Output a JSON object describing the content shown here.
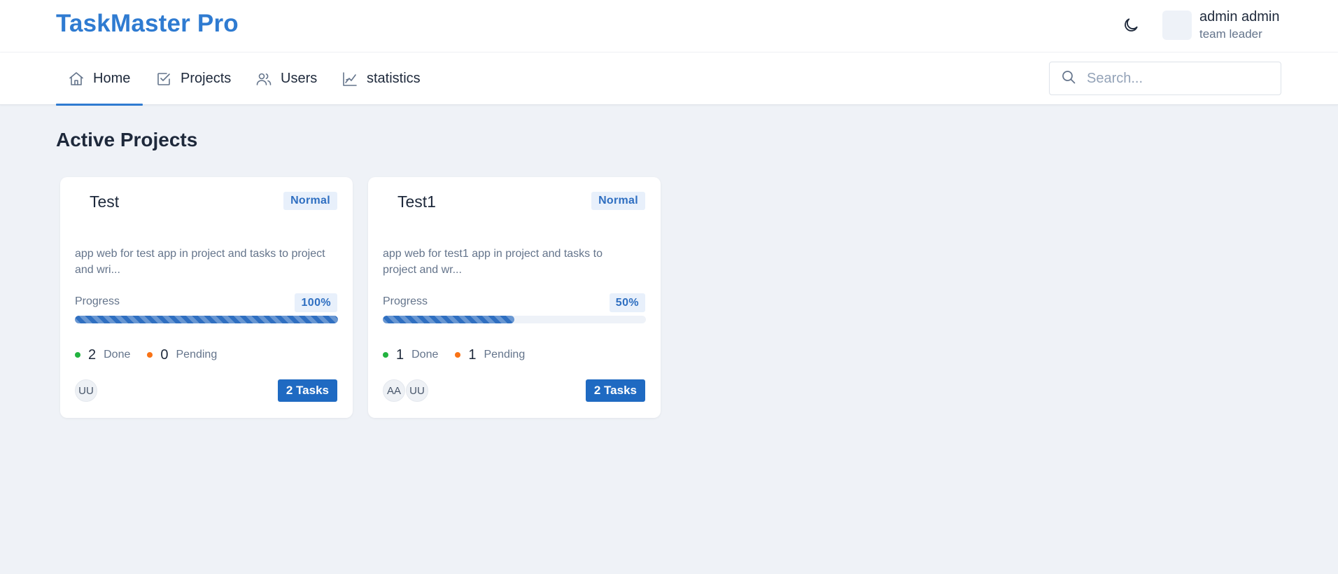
{
  "app": {
    "brand": "TaskMaster Pro"
  },
  "user": {
    "name": "admin admin",
    "role": "team leader"
  },
  "nav": {
    "items": [
      {
        "label": "Home",
        "icon": "home-icon",
        "active": true
      },
      {
        "label": "Projects",
        "icon": "checkbox-icon",
        "active": false
      },
      {
        "label": "Users",
        "icon": "users-icon",
        "active": false
      },
      {
        "label": "statistics",
        "icon": "chart-line-icon",
        "active": false
      }
    ],
    "search_placeholder": "Search..."
  },
  "section": {
    "title": "Active Projects"
  },
  "labels": {
    "progress": "Progress",
    "done": "Done",
    "pending": "Pending"
  },
  "projects": [
    {
      "title": "Test",
      "priority": "Normal",
      "description": "app web for test app in project and tasks to project and wri...",
      "progress_text": "100%",
      "progress": 100,
      "done": "2",
      "pending": "0",
      "members": [
        "UU"
      ],
      "tasks_label": "2 Tasks"
    },
    {
      "title": "Test1",
      "priority": "Normal",
      "description": "app web for test1 app in project and tasks to project and wr...",
      "progress_text": "50%",
      "progress": 50,
      "done": "1",
      "pending": "1",
      "members": [
        "AA",
        "UU"
      ],
      "tasks_label": "2 Tasks"
    }
  ],
  "colors": {
    "brand": "#2f7bd1",
    "primary": "#1f6ac2",
    "done": "#22b33f",
    "pending": "#f97316",
    "background": "#eff2f7"
  }
}
